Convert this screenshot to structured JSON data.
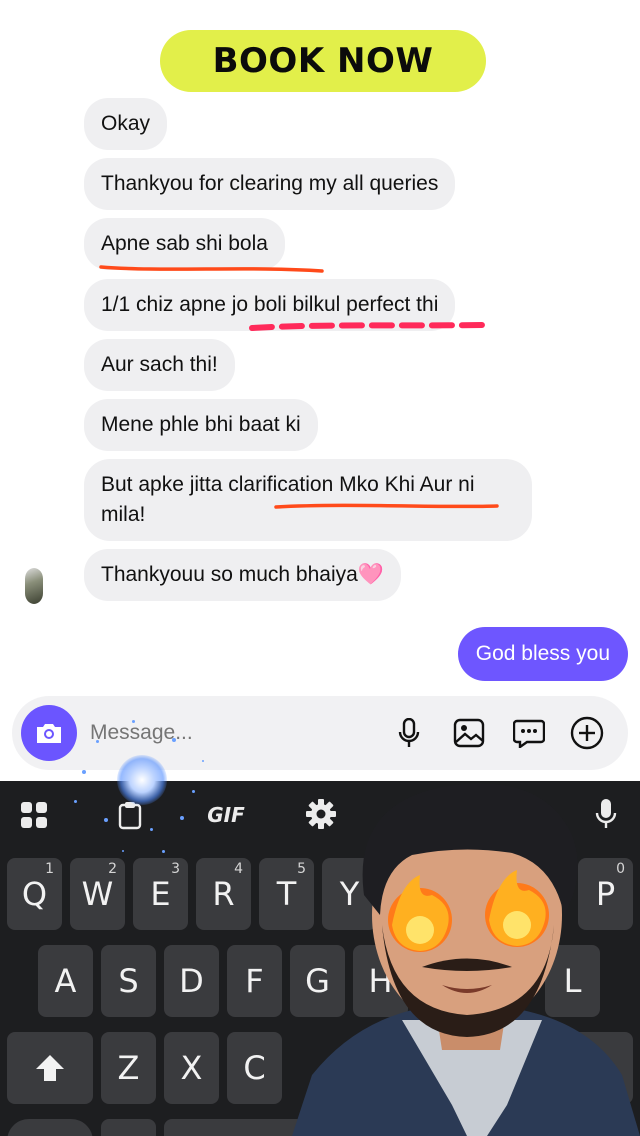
{
  "banner": {
    "label": "BOOK NOW"
  },
  "messages": [
    {
      "text": "Okay"
    },
    {
      "text": "Thankyou for clearing my all queries"
    },
    {
      "text": "Apne sab shi bola"
    },
    {
      "text": "1/1 chiz apne jo boli bilkul perfect thi"
    },
    {
      "text": "Aur sach thi!"
    },
    {
      "text": "Mene phle bhi baat ki"
    },
    {
      "text": "But apke jitta clarification Mko Khi Aur ni mila!"
    },
    {
      "text": "Thankyouu so much bhaiya🩷"
    }
  ],
  "outgoing": {
    "text": "God bless you"
  },
  "composer": {
    "placeholder": "Message..."
  },
  "keyboard": {
    "gif_label": "GIF",
    "row1": [
      {
        "label": "Q",
        "hint": "1"
      },
      {
        "label": "W",
        "hint": "2"
      },
      {
        "label": "E",
        "hint": "3"
      },
      {
        "label": "R",
        "hint": "4"
      },
      {
        "label": "T",
        "hint": "5"
      },
      {
        "label": "Y",
        "hint": ""
      },
      {
        "label": "P",
        "hint": "0"
      }
    ],
    "row2": [
      "A",
      "S",
      "D",
      "F",
      "G",
      "H",
      "L"
    ],
    "row3": [
      "Z",
      "X",
      "C"
    ]
  },
  "colors": {
    "accent": "#6b55ff",
    "banner": "#e2ef4a",
    "underline": "#ff4a1a",
    "dash": "#ff2a5a"
  }
}
